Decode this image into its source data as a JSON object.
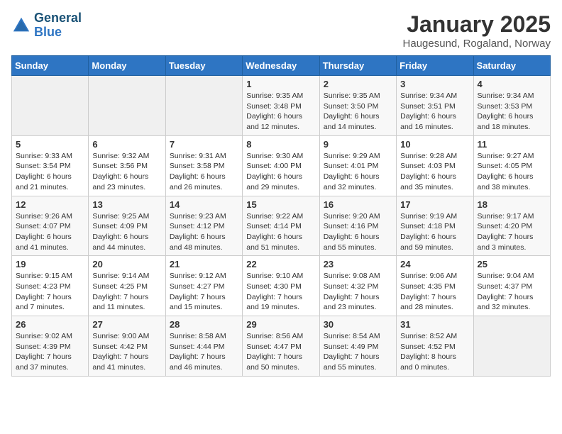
{
  "logo": {
    "line1": "General",
    "line2": "Blue"
  },
  "title": "January 2025",
  "subtitle": "Haugesund, Rogaland, Norway",
  "weekdays": [
    "Sunday",
    "Monday",
    "Tuesday",
    "Wednesday",
    "Thursday",
    "Friday",
    "Saturday"
  ],
  "weeks": [
    [
      {
        "day": "",
        "info": ""
      },
      {
        "day": "",
        "info": ""
      },
      {
        "day": "",
        "info": ""
      },
      {
        "day": "1",
        "info": "Sunrise: 9:35 AM\nSunset: 3:48 PM\nDaylight: 6 hours\nand 12 minutes."
      },
      {
        "day": "2",
        "info": "Sunrise: 9:35 AM\nSunset: 3:50 PM\nDaylight: 6 hours\nand 14 minutes."
      },
      {
        "day": "3",
        "info": "Sunrise: 9:34 AM\nSunset: 3:51 PM\nDaylight: 6 hours\nand 16 minutes."
      },
      {
        "day": "4",
        "info": "Sunrise: 9:34 AM\nSunset: 3:53 PM\nDaylight: 6 hours\nand 18 minutes."
      }
    ],
    [
      {
        "day": "5",
        "info": "Sunrise: 9:33 AM\nSunset: 3:54 PM\nDaylight: 6 hours\nand 21 minutes."
      },
      {
        "day": "6",
        "info": "Sunrise: 9:32 AM\nSunset: 3:56 PM\nDaylight: 6 hours\nand 23 minutes."
      },
      {
        "day": "7",
        "info": "Sunrise: 9:31 AM\nSunset: 3:58 PM\nDaylight: 6 hours\nand 26 minutes."
      },
      {
        "day": "8",
        "info": "Sunrise: 9:30 AM\nSunset: 4:00 PM\nDaylight: 6 hours\nand 29 minutes."
      },
      {
        "day": "9",
        "info": "Sunrise: 9:29 AM\nSunset: 4:01 PM\nDaylight: 6 hours\nand 32 minutes."
      },
      {
        "day": "10",
        "info": "Sunrise: 9:28 AM\nSunset: 4:03 PM\nDaylight: 6 hours\nand 35 minutes."
      },
      {
        "day": "11",
        "info": "Sunrise: 9:27 AM\nSunset: 4:05 PM\nDaylight: 6 hours\nand 38 minutes."
      }
    ],
    [
      {
        "day": "12",
        "info": "Sunrise: 9:26 AM\nSunset: 4:07 PM\nDaylight: 6 hours\nand 41 minutes."
      },
      {
        "day": "13",
        "info": "Sunrise: 9:25 AM\nSunset: 4:09 PM\nDaylight: 6 hours\nand 44 minutes."
      },
      {
        "day": "14",
        "info": "Sunrise: 9:23 AM\nSunset: 4:12 PM\nDaylight: 6 hours\nand 48 minutes."
      },
      {
        "day": "15",
        "info": "Sunrise: 9:22 AM\nSunset: 4:14 PM\nDaylight: 6 hours\nand 51 minutes."
      },
      {
        "day": "16",
        "info": "Sunrise: 9:20 AM\nSunset: 4:16 PM\nDaylight: 6 hours\nand 55 minutes."
      },
      {
        "day": "17",
        "info": "Sunrise: 9:19 AM\nSunset: 4:18 PM\nDaylight: 6 hours\nand 59 minutes."
      },
      {
        "day": "18",
        "info": "Sunrise: 9:17 AM\nSunset: 4:20 PM\nDaylight: 7 hours\nand 3 minutes."
      }
    ],
    [
      {
        "day": "19",
        "info": "Sunrise: 9:15 AM\nSunset: 4:23 PM\nDaylight: 7 hours\nand 7 minutes."
      },
      {
        "day": "20",
        "info": "Sunrise: 9:14 AM\nSunset: 4:25 PM\nDaylight: 7 hours\nand 11 minutes."
      },
      {
        "day": "21",
        "info": "Sunrise: 9:12 AM\nSunset: 4:27 PM\nDaylight: 7 hours\nand 15 minutes."
      },
      {
        "day": "22",
        "info": "Sunrise: 9:10 AM\nSunset: 4:30 PM\nDaylight: 7 hours\nand 19 minutes."
      },
      {
        "day": "23",
        "info": "Sunrise: 9:08 AM\nSunset: 4:32 PM\nDaylight: 7 hours\nand 23 minutes."
      },
      {
        "day": "24",
        "info": "Sunrise: 9:06 AM\nSunset: 4:35 PM\nDaylight: 7 hours\nand 28 minutes."
      },
      {
        "day": "25",
        "info": "Sunrise: 9:04 AM\nSunset: 4:37 PM\nDaylight: 7 hours\nand 32 minutes."
      }
    ],
    [
      {
        "day": "26",
        "info": "Sunrise: 9:02 AM\nSunset: 4:39 PM\nDaylight: 7 hours\nand 37 minutes."
      },
      {
        "day": "27",
        "info": "Sunrise: 9:00 AM\nSunset: 4:42 PM\nDaylight: 7 hours\nand 41 minutes."
      },
      {
        "day": "28",
        "info": "Sunrise: 8:58 AM\nSunset: 4:44 PM\nDaylight: 7 hours\nand 46 minutes."
      },
      {
        "day": "29",
        "info": "Sunrise: 8:56 AM\nSunset: 4:47 PM\nDaylight: 7 hours\nand 50 minutes."
      },
      {
        "day": "30",
        "info": "Sunrise: 8:54 AM\nSunset: 4:49 PM\nDaylight: 7 hours\nand 55 minutes."
      },
      {
        "day": "31",
        "info": "Sunrise: 8:52 AM\nSunset: 4:52 PM\nDaylight: 8 hours\nand 0 minutes."
      },
      {
        "day": "",
        "info": ""
      }
    ]
  ]
}
